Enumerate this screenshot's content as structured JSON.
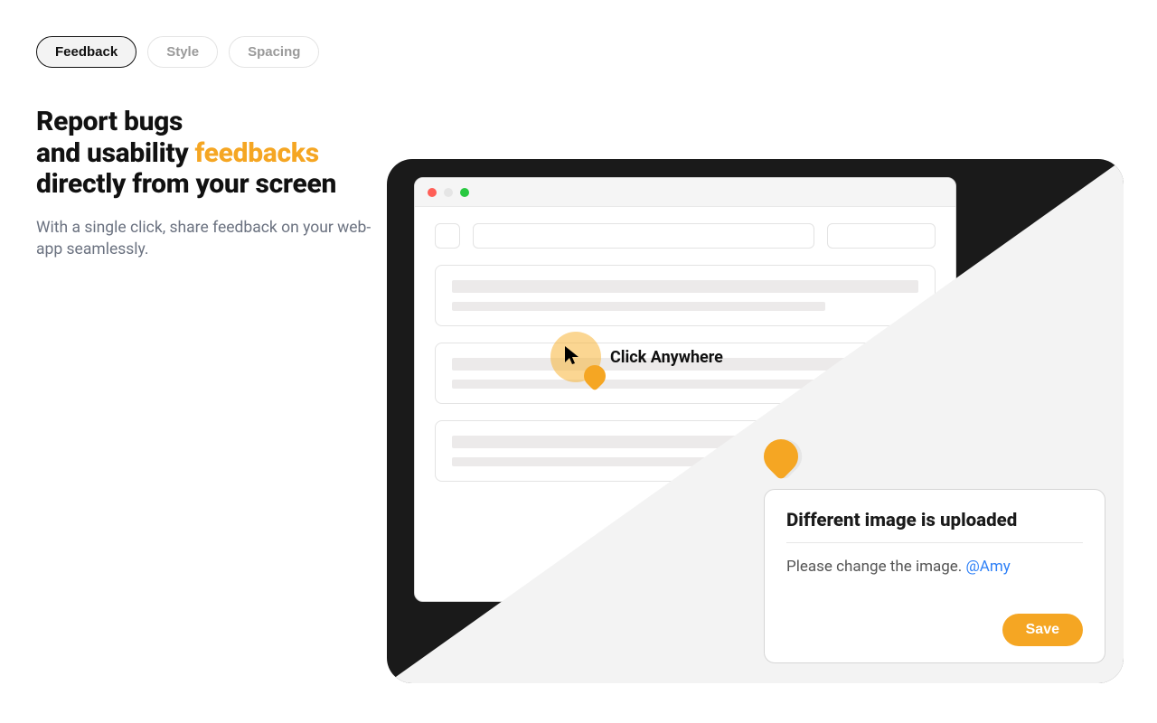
{
  "tabs": {
    "items": [
      {
        "label": "Feedback",
        "active": true
      },
      {
        "label": "Style",
        "active": false
      },
      {
        "label": "Spacing",
        "active": false
      }
    ]
  },
  "heading": {
    "line1": "Report bugs",
    "line2_pre": "and usability ",
    "line2_accent": "feedbacks",
    "line3": "directly from your screen"
  },
  "subheading": "With a single click, share feedback on your web-app seamlessly.",
  "illustration": {
    "click_hint": "Click Anywhere",
    "feedback": {
      "title": "Different image is uploaded",
      "body_text": "Please change the image. ",
      "mention": "@Amy",
      "save_label": "Save"
    }
  },
  "colors": {
    "accent": "#f5a623",
    "link": "#2f81f7"
  }
}
